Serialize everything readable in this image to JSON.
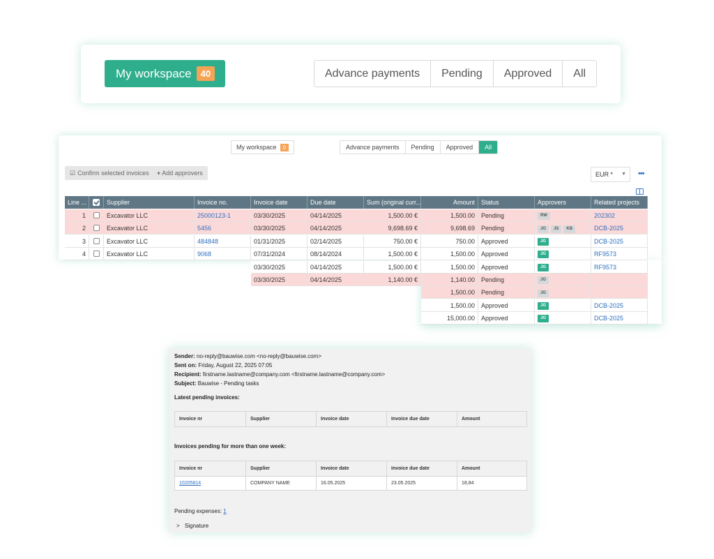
{
  "workspace_large": {
    "label": "My workspace",
    "count": "40",
    "tabs": [
      "Advance payments",
      "Pending",
      "Approved",
      "All"
    ]
  },
  "invoice_list": {
    "workspace_label": "My workspace",
    "workspace_count": "0",
    "tabs": [
      "Advance payments",
      "Pending",
      "Approved",
      "All"
    ],
    "active_tab": "All",
    "confirm_button": "Confirm selected invoices",
    "add_approvers_button": "Add approvers",
    "currency": "EUR *",
    "columns": {
      "line": "Line ...",
      "supplier": "Supplier",
      "invoice_no": "Invoice no.",
      "invoice_date": "Invoice date",
      "due_date": "Due date",
      "sum": "Sum (original curr...",
      "amount": "Amount",
      "status": "Status",
      "approvers": "Approvers",
      "related_projects": "Related projects"
    },
    "rows": [
      {
        "line": "1",
        "supplier": "Excavator LLC",
        "invoice_no": "25000123-1",
        "invoice_date": "03/30/2025",
        "due_date": "04/14/2025",
        "sum": "1,500.00 €",
        "amount": "1,500.00",
        "status": "Pending",
        "approvers": [
          "RW"
        ],
        "approvers_green": false,
        "project": "202302",
        "highlight": true
      },
      {
        "line": "2",
        "supplier": "Excavator LLC",
        "invoice_no": "5456",
        "invoice_date": "03/30/2025",
        "due_date": "04/14/2025",
        "sum": "9,698.69 €",
        "amount": "9,698.69",
        "status": "Pending",
        "approvers": [
          "JG",
          "JS",
          "KB"
        ],
        "approvers_green": false,
        "project": "DCB-2025",
        "highlight": true
      },
      {
        "line": "3",
        "supplier": "Excavator LLC",
        "invoice_no": "484848",
        "invoice_date": "01/31/2025",
        "due_date": "02/14/2025",
        "sum": "750.00 €",
        "amount": "750.00",
        "status": "Approved",
        "approvers": [
          "JG"
        ],
        "approvers_green": true,
        "project": "DCB-2025",
        "highlight": false
      },
      {
        "line": "4",
        "supplier": "Excavator LLC",
        "invoice_no": "9068",
        "invoice_date": "07/31/2024",
        "due_date": "08/14/2024",
        "sum": "1,500.00 €",
        "amount": "1,500.00",
        "status": "Approved",
        "approvers": [
          "JG"
        ],
        "approvers_green": true,
        "project": "RF9573",
        "highlight": false
      },
      {
        "line": "",
        "supplier": "",
        "invoice_no": "",
        "invoice_date": "03/30/2025",
        "due_date": "04/14/2025",
        "sum": "1,500.00 €",
        "amount": "1,500.00",
        "status": "Approved",
        "approvers": [
          "JG"
        ],
        "approvers_green": true,
        "project": "RF9573",
        "highlight": false
      },
      {
        "line": "",
        "supplier": "",
        "invoice_no": "",
        "invoice_date": "03/30/2025",
        "due_date": "04/14/2025",
        "sum": "1,140.00 €",
        "amount": "1,140.00",
        "status": "Pending",
        "approvers": [
          "JG"
        ],
        "approvers_green": false,
        "project": "",
        "highlight": true
      },
      {
        "line": "",
        "supplier": "",
        "invoice_no": "",
        "invoice_date": "",
        "due_date": "",
        "sum": "",
        "amount": "1,500.00",
        "status": "Pending",
        "approvers": [
          "JG"
        ],
        "approvers_green": false,
        "project": "",
        "highlight": true
      },
      {
        "line": "",
        "supplier": "",
        "invoice_no": "",
        "invoice_date": "",
        "due_date": "",
        "sum": "",
        "amount": "1,500.00",
        "status": "Approved",
        "approvers": [
          "JG"
        ],
        "approvers_green": true,
        "project": "DCB-2025",
        "highlight": false
      },
      {
        "line": "",
        "supplier": "",
        "invoice_no": "",
        "invoice_date": "",
        "due_date": "",
        "sum": "",
        "amount": "15,000.00",
        "status": "Approved",
        "approvers": [
          "JG"
        ],
        "approvers_green": true,
        "project": "DCB-2025",
        "highlight": false
      }
    ]
  },
  "email": {
    "sender_label": "Sender:",
    "sender": "no-reply@bauwise.com <no-reply@bauwise.com>",
    "sent_label": "Sent on:",
    "sent": "Friday, August 22, 2025 07:05",
    "recipient_label": "Recipient:",
    "recipient": "firstname.lastname@company.com <firstname.lastname@company.com>",
    "subject_label": "Subject:",
    "subject": "Bauwise - Pending tasks",
    "latest_heading": "Latest pending invoices:",
    "week_heading": "Invoices pending for more than one week:",
    "table_headers": [
      "Invoice nr",
      "Supplier",
      "Invoice date",
      "Invoice due date",
      "Amount"
    ],
    "week_row": {
      "invoice_nr": "10205814",
      "supplier": "COMPANY NAME",
      "invoice_date": "16.05.2025",
      "due_date": "23.05.2025",
      "amount": "18,84"
    },
    "pending_expenses_label": "Pending expenses:",
    "pending_expenses_count": "1",
    "signature_label": "Signature"
  }
}
